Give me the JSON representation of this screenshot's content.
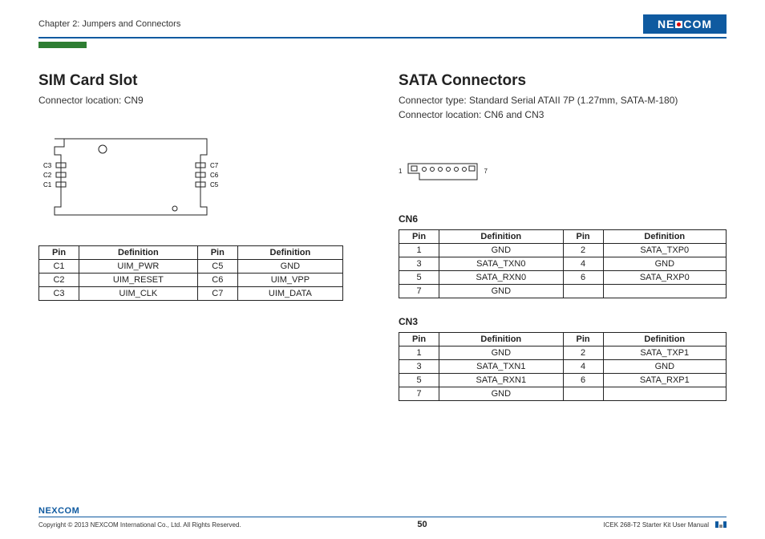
{
  "header": {
    "chapter": "Chapter 2: Jumpers and Connectors",
    "brand": "NE COM"
  },
  "left": {
    "title": "SIM Card Slot",
    "subtitle": "Connector location: CN9",
    "diagram_labels_left": [
      "C3",
      "C2",
      "C1"
    ],
    "diagram_labels_right": [
      "C7",
      "C6",
      "C5"
    ],
    "table": {
      "headers": [
        "Pin",
        "Definition",
        "Pin",
        "Definition"
      ],
      "rows": [
        [
          "C1",
          "UIM_PWR",
          "C5",
          "GND"
        ],
        [
          "C2",
          "UIM_RESET",
          "C6",
          "UIM_VPP"
        ],
        [
          "C3",
          "UIM_CLK",
          "C7",
          "UIM_DATA"
        ]
      ]
    }
  },
  "right": {
    "title": "SATA Connectors",
    "subtitle1": "Connector type: Standard Serial ATAII 7P (1.27mm, SATA-M-180)",
    "subtitle2": "Connector location: CN6 and CN3",
    "diagram_left": "1",
    "diagram_right": "7",
    "cn6": {
      "label": "CN6",
      "headers": [
        "Pin",
        "Definition",
        "Pin",
        "Definition"
      ],
      "rows": [
        [
          "1",
          "GND",
          "2",
          "SATA_TXP0"
        ],
        [
          "3",
          "SATA_TXN0",
          "4",
          "GND"
        ],
        [
          "5",
          "SATA_RXN0",
          "6",
          "SATA_RXP0"
        ],
        [
          "7",
          "GND",
          "",
          ""
        ]
      ]
    },
    "cn3": {
      "label": "CN3",
      "headers": [
        "Pin",
        "Definition",
        "Pin",
        "Definition"
      ],
      "rows": [
        [
          "1",
          "GND",
          "2",
          "SATA_TXP1"
        ],
        [
          "3",
          "SATA_TXN1",
          "4",
          "GND"
        ],
        [
          "5",
          "SATA_RXN1",
          "6",
          "SATA_RXP1"
        ],
        [
          "7",
          "GND",
          "",
          ""
        ]
      ]
    }
  },
  "footer": {
    "brand": "NEXCOM",
    "copyright": "Copyright © 2013 NEXCOM International Co., Ltd. All Rights Reserved.",
    "page": "50",
    "manual": "ICEK 268-T2 Starter Kit User Manual"
  }
}
